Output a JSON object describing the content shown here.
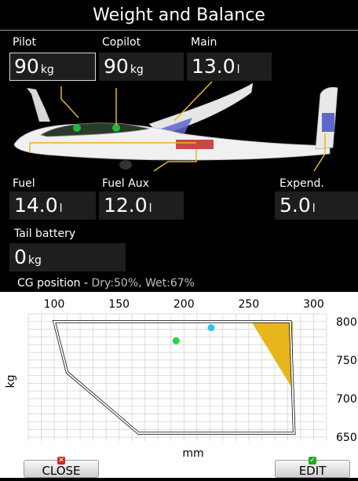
{
  "title": "Weight and Balance",
  "fields": {
    "pilot": {
      "label": "Pilot",
      "value": "90",
      "unit": "kg"
    },
    "copilot": {
      "label": "Copilot",
      "value": "90",
      "unit": "kg"
    },
    "main": {
      "label": "Main",
      "value": "13.0",
      "unit": "l"
    },
    "fuel": {
      "label": "Fuel",
      "value": "14.0",
      "unit": "l"
    },
    "fuel_aux": {
      "label": "Fuel Aux",
      "value": "12.0",
      "unit": "l"
    },
    "expend": {
      "label": "Expend.",
      "value": "5.0",
      "unit": "l"
    },
    "tail_battery": {
      "label": "Tail battery",
      "value": "0",
      "unit": "kg"
    }
  },
  "cg": {
    "label": "CG position - ",
    "value": "Dry:50%, Wet:67%"
  },
  "buttons": {
    "close": "CLOSE",
    "edit": "EDIT"
  },
  "colors": {
    "accent_yellow": "#e8b61c",
    "point_green": "#22d83a",
    "point_cyan": "#2cc6f2",
    "fuel_red": "#c84848"
  },
  "chart_data": {
    "type": "scatter",
    "xlabel": "mm",
    "ylabel": "kg",
    "x_ticks": [
      "100",
      "150",
      "200",
      "250",
      "300"
    ],
    "y_ticks": [
      "800",
      "750",
      "700",
      "650"
    ],
    "xlim": [
      80,
      310
    ],
    "ylim": [
      645,
      810
    ],
    "envelope": [
      [
        100,
        800
      ],
      [
        110,
        734
      ],
      [
        165,
        655
      ],
      [
        285,
        655
      ],
      [
        282,
        800
      ]
    ],
    "expend_region": [
      [
        252,
        800
      ],
      [
        284,
        800
      ],
      [
        284,
        712
      ]
    ],
    "points": [
      {
        "x": 194,
        "y": 775,
        "color": "#22d83a"
      },
      {
        "x": 221,
        "y": 792,
        "color": "#2cc6f2"
      }
    ]
  }
}
